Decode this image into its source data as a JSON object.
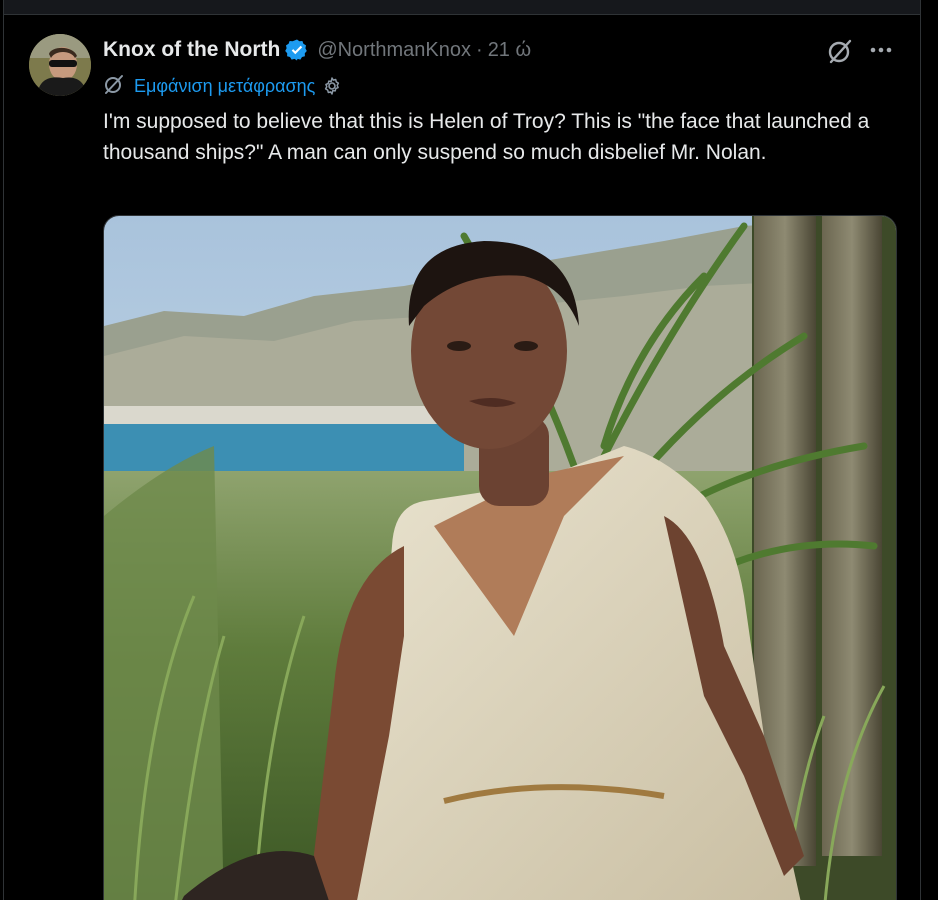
{
  "tweet": {
    "display_name": "Knox of the North",
    "handle": "@NorthmanKnox",
    "separator": "·",
    "time": "21 ώ",
    "translate_label": "Εμφάνιση μετάφρασης",
    "text": "I'm supposed to believe that this is Helen of Troy? This is \"the face that launched a thousand ships?\" A man can only suspend so much disbelief Mr. Nolan."
  },
  "icons": {
    "verified": "verified-badge-icon",
    "grok": "grok-slash-icon",
    "more": "more-dots-icon",
    "translate": "translate-icon",
    "settings": "settings-gear-icon"
  },
  "colors": {
    "background": "#000000",
    "text": "#e7e9ea",
    "muted": "#71767b",
    "accent": "#1d9bf0"
  }
}
